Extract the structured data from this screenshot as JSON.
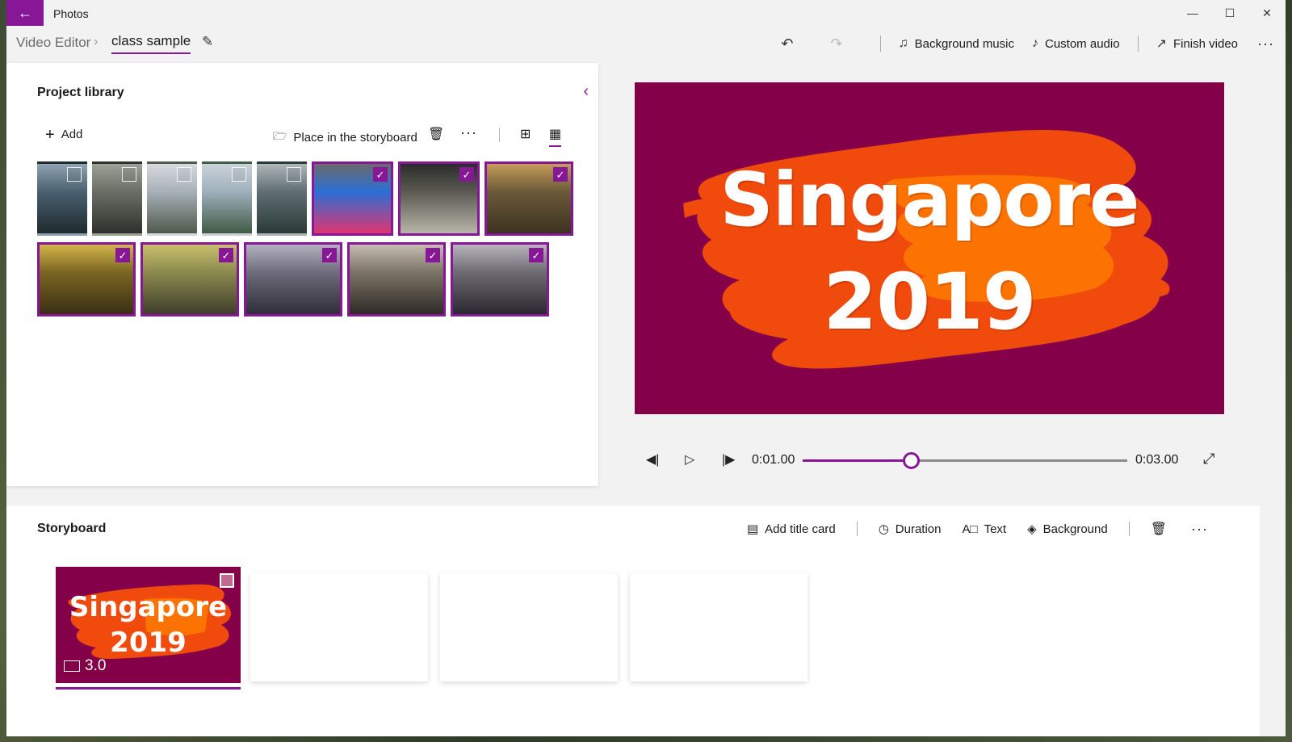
{
  "app": {
    "title": "Photos",
    "accent_color": "#881798",
    "back_icon": "back-arrow-icon",
    "window_controls": [
      "minimize",
      "maximize",
      "close"
    ]
  },
  "breadcrumb": {
    "root": "Video Editor",
    "current": "class sample"
  },
  "command_bar": {
    "background_music": "Background music",
    "custom_audio": "Custom audio",
    "finish_video": "Finish video"
  },
  "library": {
    "title": "Project library",
    "add_label": "Add",
    "place_label": "Place in the storyboard",
    "thumbnails": [
      {
        "id": 1,
        "selected": false,
        "colors": [
          "#4a6070",
          "#1e2a2e",
          "#8fa3b0"
        ]
      },
      {
        "id": 2,
        "selected": false,
        "colors": [
          "#6a6f66",
          "#2e302c",
          "#9da299"
        ]
      },
      {
        "id": 3,
        "selected": false,
        "colors": [
          "#a8b0b8",
          "#4d5a4a",
          "#d7dadf"
        ]
      },
      {
        "id": 4,
        "selected": false,
        "colors": [
          "#9fb0bc",
          "#3f5a45",
          "#cbd3d8"
        ]
      },
      {
        "id": 5,
        "selected": false,
        "colors": [
          "#5f6e73",
          "#2a3b36",
          "#aeb6b8"
        ]
      },
      {
        "id": 6,
        "selected": true,
        "colors": [
          "#2a6fd4",
          "#e03570",
          "#6b6b6b"
        ]
      },
      {
        "id": 7,
        "selected": true,
        "colors": [
          "#5a5a52",
          "#b8b5aa",
          "#2b2b2b"
        ]
      },
      {
        "id": 8,
        "selected": true,
        "colors": [
          "#6b5a3a",
          "#3d3221",
          "#c59c5a"
        ]
      },
      {
        "id": 9,
        "selected": true,
        "colors": [
          "#7a6522",
          "#3a2f14",
          "#d2b54a"
        ]
      },
      {
        "id": 10,
        "selected": true,
        "colors": [
          "#8b8a4f",
          "#3f3e2a",
          "#c9bf6b"
        ]
      },
      {
        "id": 11,
        "selected": true,
        "colors": [
          "#6e6b7a",
          "#2f2d38",
          "#b3b0c0"
        ]
      },
      {
        "id": 12,
        "selected": true,
        "colors": [
          "#7b7466",
          "#2e2a25",
          "#c4bdb0"
        ]
      },
      {
        "id": 13,
        "selected": true,
        "colors": [
          "#6e6a72",
          "#2a282e",
          "#b9b4bc"
        ]
      }
    ]
  },
  "preview": {
    "line1": "Singapore",
    "line2": "2019",
    "bg_color": "#840049",
    "splash_colors": [
      "#f04a0c",
      "#ff7a00"
    ]
  },
  "playback": {
    "current_time": "0:01.00",
    "total_time": "0:03.00",
    "progress": 0.333
  },
  "storyboard": {
    "title": "Storyboard",
    "add_title_card": "Add title card",
    "duration": "Duration",
    "text": "Text",
    "background": "Background",
    "clips": [
      {
        "line1": "Singapore",
        "line2": "2019",
        "duration": "3.0"
      }
    ]
  }
}
